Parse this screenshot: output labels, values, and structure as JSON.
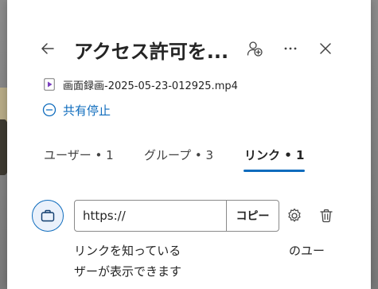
{
  "dialog": {
    "title": "アクセス許可を..."
  },
  "file": {
    "name": "画面録画-2025-05-23-012925.mp4"
  },
  "stop_sharing": {
    "label": "共有停止"
  },
  "tabs": [
    {
      "label": "ユーザー • 1"
    },
    {
      "label": "グループ • 3"
    },
    {
      "label": "リンク • 1"
    }
  ],
  "link": {
    "value": "https://",
    "copy_label": "コピー",
    "description_line1": "リンクを知っている",
    "description_line1_tail": "のユー",
    "description_line2": "ザーが表示できます"
  },
  "colors": {
    "accent": "#0f6cbd",
    "text": "#242424",
    "file_icon": "#7b3fbf"
  }
}
